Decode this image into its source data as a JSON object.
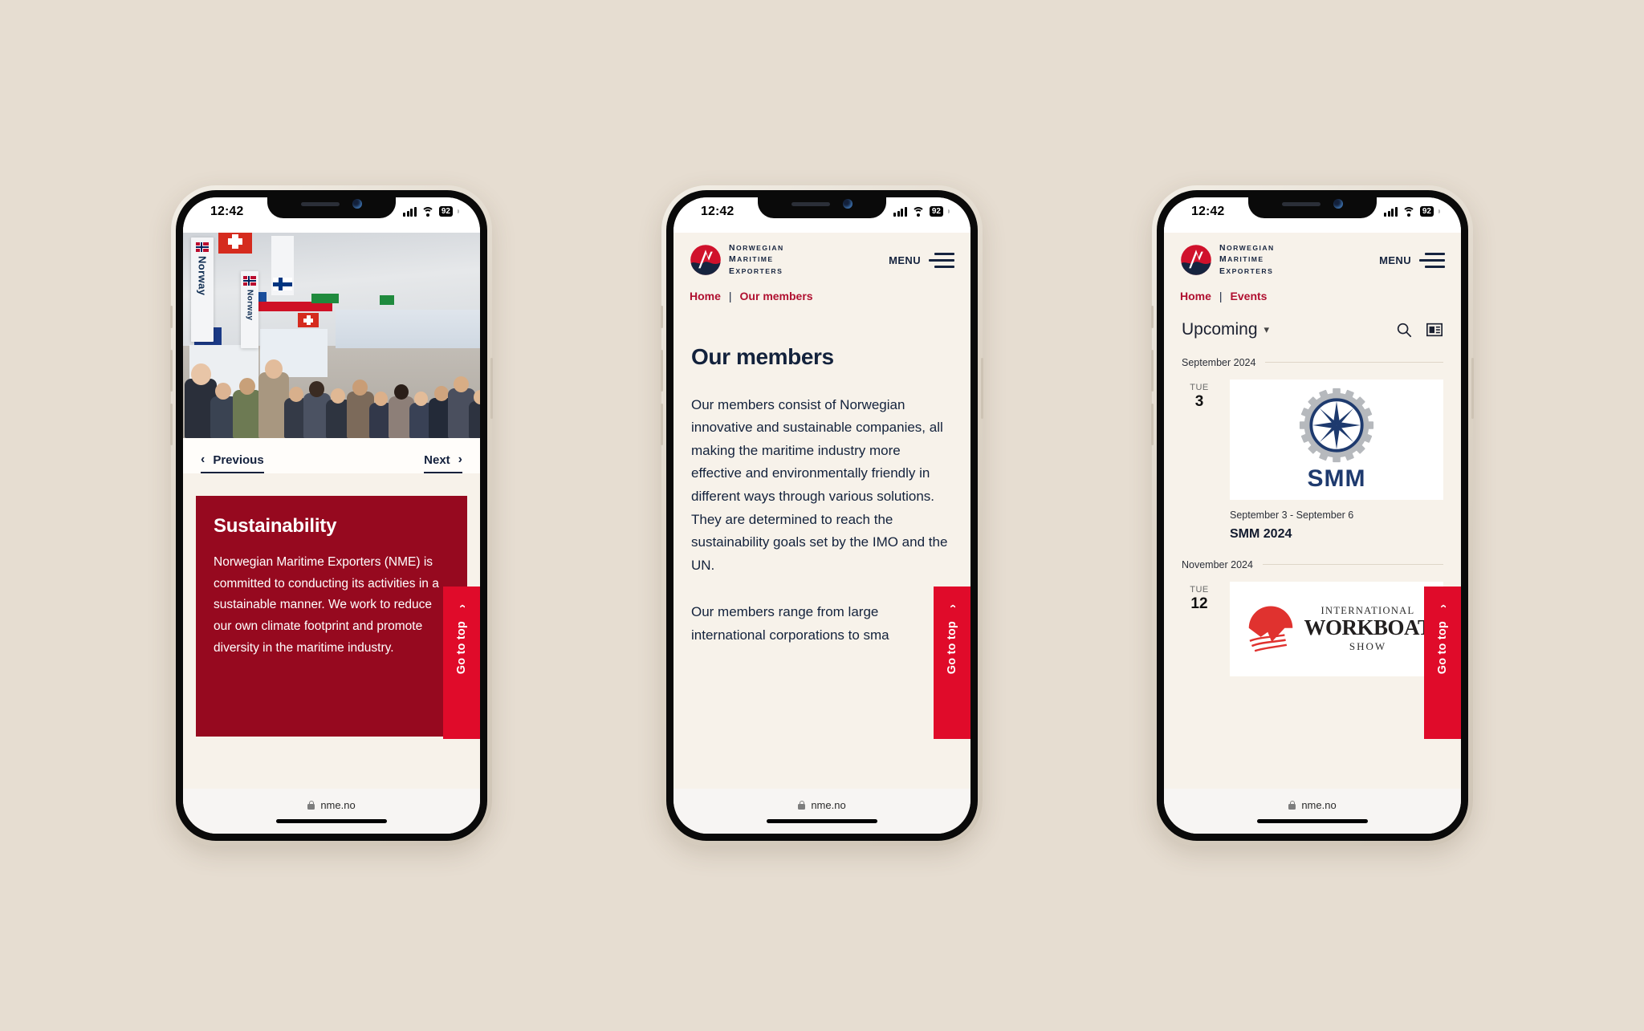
{
  "canvas": {
    "background": "#e6ddd1"
  },
  "brand": {
    "line1": "NORWEGIAN",
    "line2": "MARITIME",
    "line3": "EXPORTERS",
    "colors": {
      "navy": "#16243f",
      "red": "#d0112b",
      "crimson": "#96091f",
      "accent": "#e00b2a"
    }
  },
  "status_bar": {
    "time": "12:42",
    "battery": "92"
  },
  "browser_bar": {
    "url": "nme.no",
    "lock_icon": "lock-icon"
  },
  "go_to_top": {
    "label": "Go to top",
    "icon": "chevron-up-icon"
  },
  "menu": {
    "label": "MENU",
    "icon": "hamburger-icon"
  },
  "phone1": {
    "hero": {
      "alt": "trade-show-exhibition-hall-crowd",
      "banner_text": "Norway"
    },
    "pager": {
      "previous": {
        "label": "Previous",
        "icon": "chevron-left-icon"
      },
      "next": {
        "label": "Next",
        "icon": "chevron-right-icon"
      }
    },
    "card": {
      "title": "Sustainability",
      "body": "Norwegian Maritime Exporters (NME) is committed to conducting its activities in a sustainable manner. We work to reduce our own climate footprint and promote diversity in the maritime industry."
    }
  },
  "phone2": {
    "breadcrumb": {
      "home": "Home",
      "separator": "|",
      "current": "Our members"
    },
    "title": "Our members",
    "paragraphs": [
      "Our members consist of Norwegian innovative and sustainable companies, all making the maritime industry more effective and environmentally friendly in different ways through various solutions. They are determined to reach the sustainability goals set by the IMO and the UN.",
      "Our members range from large international corporations to sma"
    ]
  },
  "phone3": {
    "breadcrumb": {
      "home": "Home",
      "separator": "|",
      "current": "Events"
    },
    "toolbar": {
      "filter_label": "Upcoming",
      "filter_icon": "chevron-down-icon",
      "search_icon": "search-icon",
      "list_view_icon": "list-view-icon"
    },
    "groups": [
      {
        "month": "September 2024",
        "events": [
          {
            "dow": "TUE",
            "day": "3",
            "when": "September 3 - September 6",
            "title": "SMM 2024",
            "logo": "smm-logo",
            "logo_text": "SMM"
          }
        ]
      },
      {
        "month": "November 2024",
        "events": [
          {
            "dow": "TUE",
            "day": "12",
            "when": "",
            "title": "",
            "logo": "international-workboat-show-logo",
            "logo_top": "INTERNATIONAL",
            "logo_mid": "WORKBOAT",
            "logo_bottom": "SHOW"
          }
        ]
      }
    ]
  }
}
